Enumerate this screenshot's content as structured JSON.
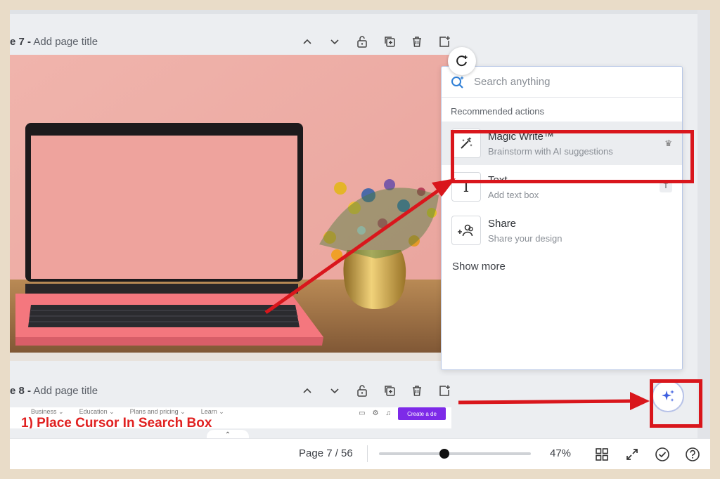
{
  "pages": [
    {
      "number_label": "e 7 -",
      "title_placeholder": "Add page title"
    },
    {
      "number_label": "e 8 -",
      "title_placeholder": "Add page title"
    }
  ],
  "page_tools": [
    "chevron-up-icon",
    "chevron-down-icon",
    "lock-icon",
    "duplicate-icon",
    "trash-icon",
    "add-page-icon"
  ],
  "next_page_preview": {
    "nav_items": [
      "Business ⌄",
      "Education ⌄",
      "Plans and pricing ⌄",
      "Learn ⌄"
    ],
    "create_button": "Create a de",
    "heading": "1) Place Cursor In Search Box"
  },
  "panel": {
    "search_placeholder": "Search anything",
    "section_title": "Recommended actions",
    "actions": [
      {
        "title": "Magic Write™",
        "subtitle": "Brainstorm with AI suggestions",
        "icon": "magic-wand-icon",
        "badge": "♛"
      },
      {
        "title": "Text",
        "subtitle": "Add text box",
        "icon": "text-T-icon",
        "badge": "T"
      },
      {
        "title": "Share",
        "subtitle": "Share your design",
        "icon": "share-people-icon",
        "badge": ""
      }
    ],
    "show_more": "Show more"
  },
  "bottom_bar": {
    "page_indicator": "Page 7 / 56",
    "zoom_level": "47%",
    "zoom_fraction": 0.43
  },
  "colors": {
    "annotation_red": "#d9161c",
    "accent_purple": "#7d2ae8"
  }
}
